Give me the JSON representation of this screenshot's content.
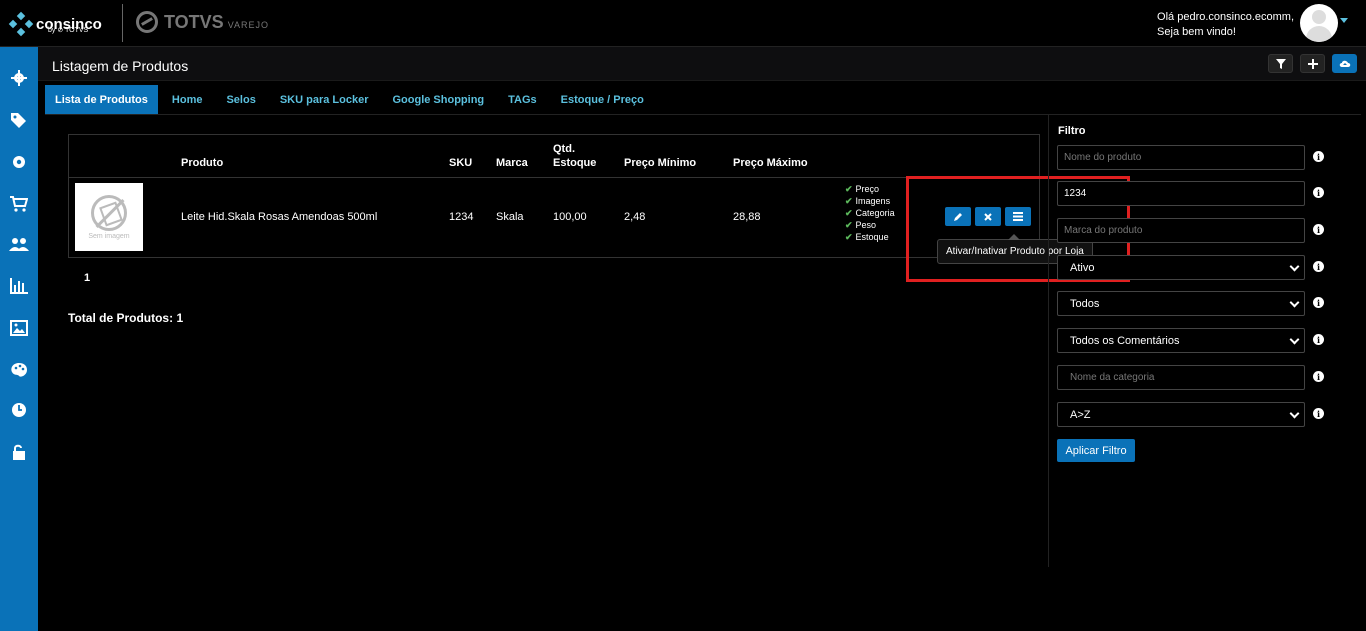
{
  "brand": {
    "consinco": "consinco",
    "by_totvs": "by ⊘ TOTVS",
    "totvs": "TOTVS",
    "varejo": "VAREJO"
  },
  "user": {
    "greeting_line1": "Olá pedro.consinco.ecomm,",
    "greeting_line2": "Seja bem vindo!"
  },
  "sidebar": {
    "items": [
      {
        "icon": "gear-icon"
      },
      {
        "icon": "tags-icon"
      },
      {
        "icon": "cog-icon"
      },
      {
        "icon": "cart-icon"
      },
      {
        "icon": "users-icon"
      },
      {
        "icon": "bar-chart-icon"
      },
      {
        "icon": "image-icon"
      },
      {
        "icon": "palette-icon"
      },
      {
        "icon": "clock-icon"
      },
      {
        "icon": "unlock-icon"
      }
    ]
  },
  "header": {
    "title": "Listagem de Produtos"
  },
  "tabs": [
    {
      "label": "Lista de Produtos",
      "active": true
    },
    {
      "label": "Home"
    },
    {
      "label": "Selos"
    },
    {
      "label": "SKU para Locker"
    },
    {
      "label": "Google Shopping"
    },
    {
      "label": "TAGs"
    },
    {
      "label": "Estoque / Preço"
    }
  ],
  "table": {
    "columns": {
      "produto": "Produto",
      "sku": "SKU",
      "marca": "Marca",
      "qtd_line1": "Qtd.",
      "qtd_line2": "Estoque",
      "preco_min": "Preço Mínimo",
      "preco_max": "Preço Máximo"
    },
    "rows": [
      {
        "image_caption": "Sem imagem",
        "produto": "Leite Hid.Skala Rosas Amendoas 500ml",
        "sku": "1234",
        "marca": "Skala",
        "estoque": "100,00",
        "preco_min": "2,48",
        "preco_max": "28,88",
        "checks": [
          "Preço",
          "Imagens",
          "Categoria",
          "Peso",
          "Estoque"
        ]
      }
    ],
    "tooltip": "Ativar/Inativar Produto por Loja"
  },
  "pager": {
    "page": "1"
  },
  "total": "Total de Produtos: 1",
  "filter": {
    "title": "Filtro",
    "nome_placeholder": "Nome do produto",
    "sku_value": "1234",
    "marca_placeholder": "Marca do produto",
    "status_value": "Ativo",
    "todos_value": "Todos",
    "comentarios_value": "Todos os Comentários",
    "categoria_placeholder": "Nome da categoria",
    "ordem_value": "A>Z",
    "apply_label": "Aplicar Filtro"
  },
  "colors": {
    "accent": "#0a72b8",
    "tab_link": "#5bc0de",
    "check": "#5cb85c",
    "highlight": "#e02020"
  }
}
